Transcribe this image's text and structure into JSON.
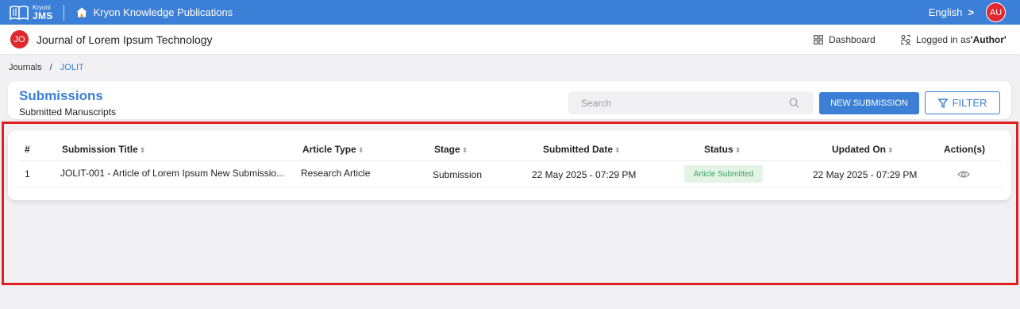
{
  "topbar": {
    "logo_small": "Kryoni",
    "logo_big": "JMS",
    "publisher": "Kryon Knowledge Publications",
    "language": "English",
    "language_chevron": ">",
    "user_initials": "AU"
  },
  "journalbar": {
    "journal_initials": "JO",
    "journal_title": "Journal of Lorem Ipsum Technology",
    "dashboard": "Dashboard",
    "logged_prefix": "Logged in as ",
    "logged_role": "'Author'"
  },
  "breadcrumb": {
    "root": "Journals",
    "separator": "/",
    "current": "JOLIT"
  },
  "header": {
    "title": "Submissions",
    "subtitle": "Submitted Manuscripts",
    "search_placeholder": "Search",
    "new_submission": "NEW SUBMISSION",
    "filter": "FILTER"
  },
  "table": {
    "sort_glyph": "⬍",
    "columns": {
      "number": "#",
      "title": "Submission Title",
      "article_type": "Article Type",
      "stage": "Stage",
      "submitted_date": "Submitted Date",
      "status": "Status",
      "updated_on": "Updated On",
      "actions": "Action(s)"
    },
    "rows": [
      {
        "number": "1",
        "title": "JOLIT-001 - Article of Lorem Ipsum New Submissio...",
        "article_type": "Research Article",
        "stage": "Submission",
        "submitted_date": "22 May 2025 - 07:29 PM",
        "status": "Article Submitted",
        "updated_on": "22 May 2025 - 07:29 PM",
        "action_icon": "eye-icon"
      }
    ]
  },
  "colors": {
    "primary": "#3b7fd6",
    "avatar": "#e0282e",
    "status_bg": "#e3f4e7",
    "status_text": "#3f9f5a",
    "highlight": "#e02020"
  }
}
